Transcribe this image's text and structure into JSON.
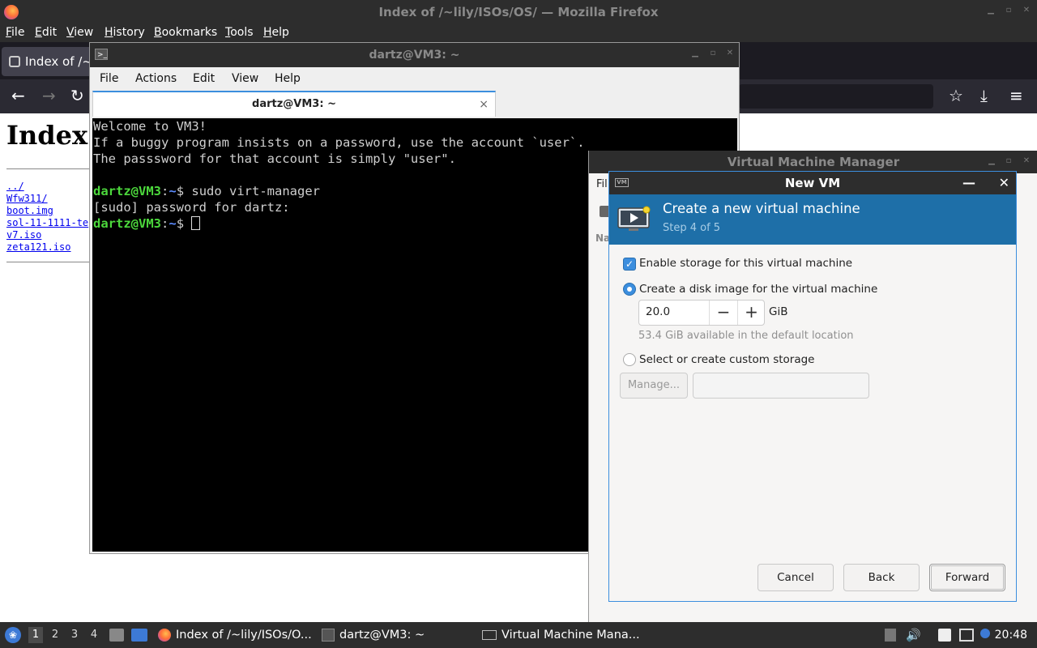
{
  "firefox": {
    "window_title": "Index of /~lily/ISOs/OS/ — Mozilla Firefox",
    "menu": [
      "File",
      "Edit",
      "View",
      "History",
      "Bookmarks",
      "Tools",
      "Help"
    ],
    "tab_label": "Index of /~l",
    "page_heading": "Index",
    "links": [
      "../",
      "Wfw311/",
      "boot.img",
      "sol-11-1111-te",
      "v7.iso",
      "zeta121.iso"
    ]
  },
  "terminal": {
    "window_title": "dartz@VM3: ~",
    "menu": [
      "File",
      "Actions",
      "Edit",
      "View",
      "Help"
    ],
    "tab_label": "dartz@VM3: ~",
    "tab_close": "×",
    "lines": {
      "l1": "Welcome to VM3!",
      "l2": "If a buggy program insists on a password, use the account `user`.",
      "l3": "The passsword for that account is simply \"user\".",
      "prompt_user": "dartz@VM3",
      "prompt_colon": ":",
      "prompt_path": "~",
      "prompt_dollar": "$ ",
      "cmd1": "sudo virt-manager",
      "l5": "[sudo] password for dartz:"
    }
  },
  "virt_manager": {
    "window_title": "Virtual Machine Manager",
    "menu_fragment": "Fil",
    "column_fragment": "Na"
  },
  "new_vm": {
    "title": "New VM",
    "header_title": "Create a new virtual machine",
    "step": "Step 4 of 5",
    "enable_storage_label": "Enable storage for this virtual machine",
    "enable_storage_checked": true,
    "create_disk_label": "Create a disk image for the virtual machine",
    "disk_size": "20.0",
    "disk_unit": "GiB",
    "available_text": "53.4 GiB available in the default location",
    "custom_storage_label": "Select or create custom storage",
    "selected_option": "create-disk",
    "manage_label": "Manage...",
    "buttons": {
      "cancel": "Cancel",
      "back": "Back",
      "forward": "Forward"
    }
  },
  "taskbar": {
    "workspaces": [
      "1",
      "2",
      "3",
      "4"
    ],
    "active_workspace": "1",
    "tasks": [
      "Index of /~lily/ISOs/O...",
      "dartz@VM3: ~",
      "Virtual Machine Mana..."
    ],
    "clock": "20:48"
  },
  "colors": {
    "dialog_header": "#1e6fa8",
    "accent": "#3c8ede",
    "prompt_green": "#4cd83c",
    "prompt_blue": "#5c8cff"
  }
}
